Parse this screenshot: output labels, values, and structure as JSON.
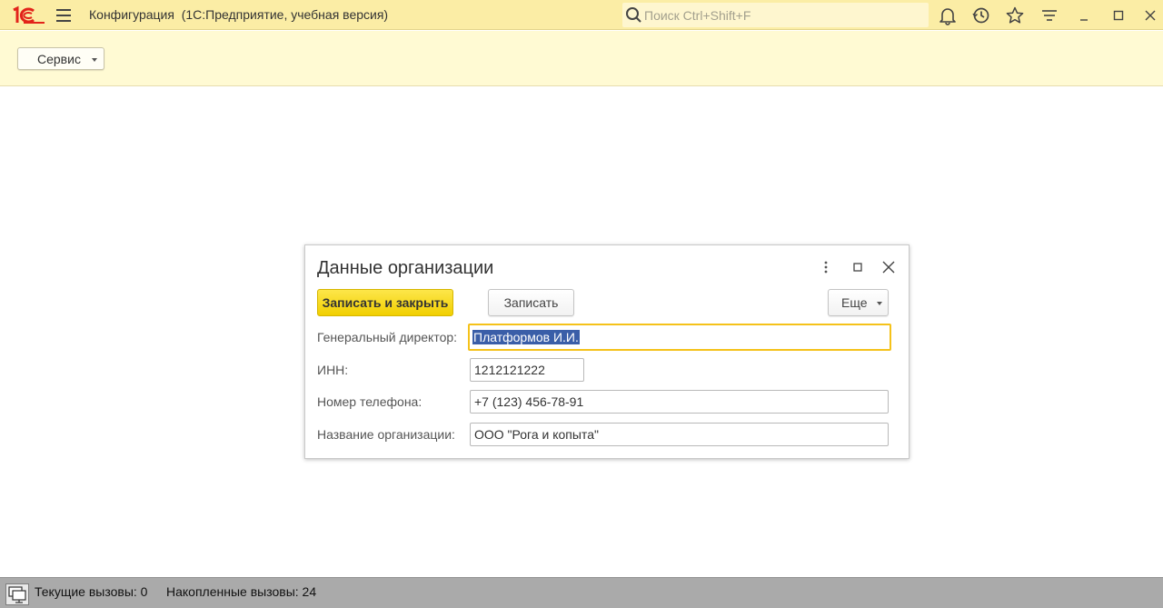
{
  "titlebar": {
    "logo_text": "1С",
    "title": "Конфигурация  (1С:Предприятие, учебная версия)",
    "search_placeholder": "Поиск Ctrl+Shift+F",
    "icons": [
      "bell-icon",
      "history-icon",
      "star-icon",
      "filter-lines-icon",
      "minimize-icon",
      "maximize-icon",
      "close-icon"
    ]
  },
  "commandbar": {
    "service_label": "Сервис"
  },
  "dialog": {
    "title": "Данные организации",
    "save_close_label": "Записать и закрыть",
    "save_label": "Записать",
    "more_label": "Еще",
    "fields": [
      {
        "label": "Генеральный директор:",
        "value": "Платформов И.И."
      },
      {
        "label": "ИНН:",
        "value": "1212121222"
      },
      {
        "label": "Номер телефона:",
        "value": "+7 (123) 456-78-91"
      },
      {
        "label": "Название организации:",
        "value": "ООО \"Рога и копыта\""
      }
    ]
  },
  "statusbar": {
    "current_calls": "Текущие вызовы: 0",
    "accumulated_calls": "Накопленные вызовы: 24"
  },
  "colors": {
    "titlebar_bg": "#fbeda5",
    "commandbar_bg": "#fffad3",
    "primary_button": "#f1cf00",
    "focus_border": "#f5c21a",
    "logo_red": "#e2231a",
    "statusbar_bg": "#aaaaaa"
  }
}
